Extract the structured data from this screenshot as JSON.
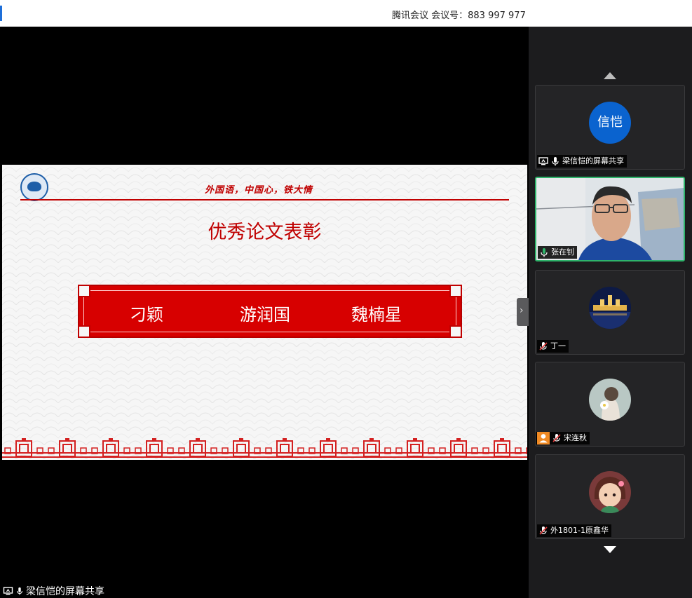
{
  "window": {
    "title": "腾讯会议 会议号：883 997 977"
  },
  "slide": {
    "motto": "外国语，中国心，铁大情",
    "title": "优秀论文表彰",
    "names": [
      "刁颖",
      "游润国",
      "魏楠星"
    ]
  },
  "participants": [
    {
      "name": "梁信恺的屏幕共享",
      "avatar_text": "信恺",
      "mic": "on",
      "sharing": true
    },
    {
      "name": "张在钊",
      "mic": "speaking",
      "video": true
    },
    {
      "name": "丁一",
      "mic": "muted"
    },
    {
      "name": "宋连秋",
      "mic": "muted",
      "host": true
    },
    {
      "name": "外1801-1原鑫华",
      "mic": "muted"
    }
  ],
  "share_label": "梁信恺的屏幕共享",
  "colors": {
    "accent": "#c00000",
    "speaking": "#2eb36a",
    "avatar_blue": "#0a63cf"
  },
  "icons": {
    "scroll_up": "chevron-up-icon",
    "scroll_down": "chevron-down-icon",
    "collapse": "chevron-right-icon"
  }
}
